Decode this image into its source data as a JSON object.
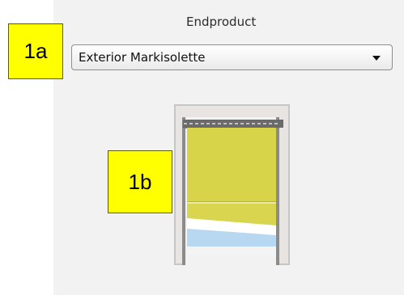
{
  "endproduct": {
    "label": "Endproduct",
    "selected_value": "Exterior Markisolette",
    "icon": "chevron-down-icon"
  },
  "callouts": {
    "a": "1a",
    "b": "1b"
  },
  "product_image": {
    "description": "product preview"
  },
  "colors": {
    "panel_background": "#f2f2f2",
    "callout_yellow": "#ffff00",
    "fabric_yellow": "#d8d44a"
  }
}
